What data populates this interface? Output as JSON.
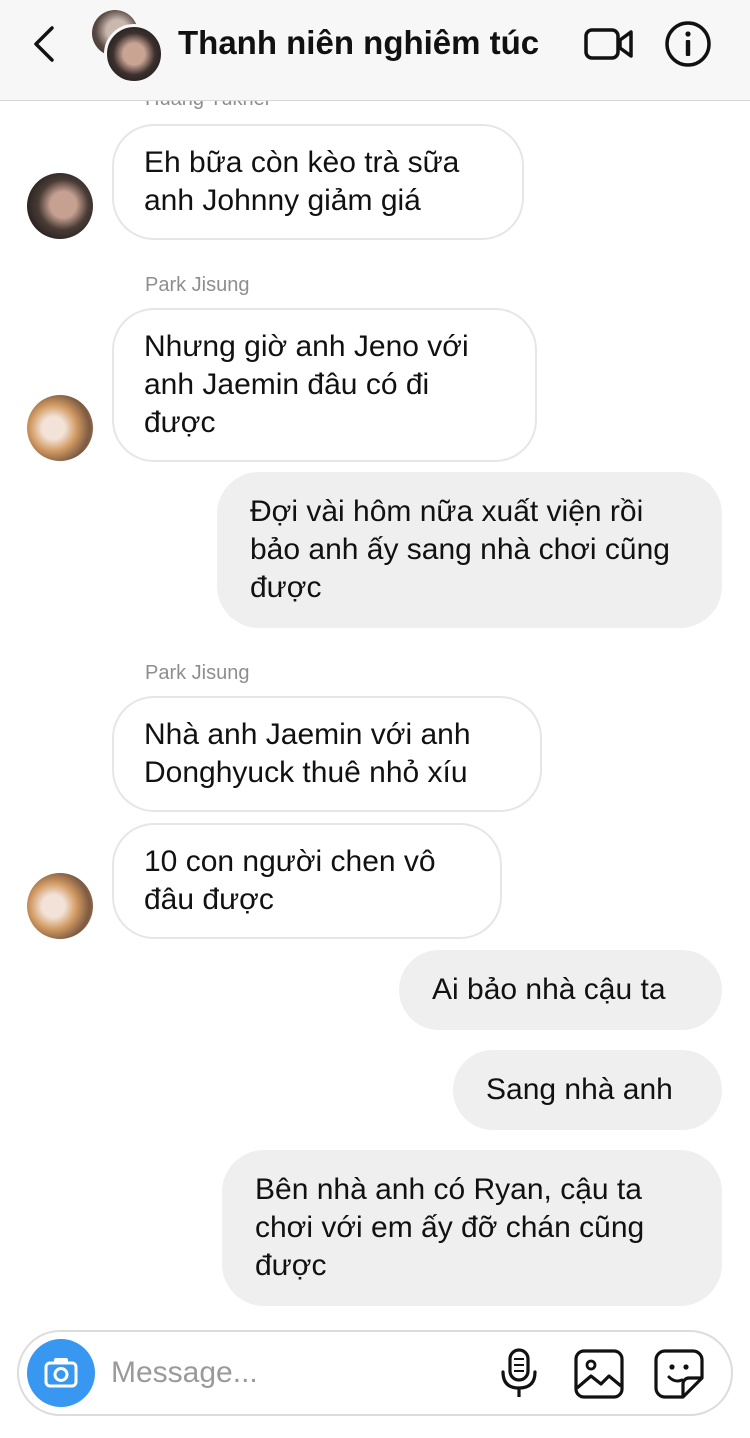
{
  "header": {
    "title": "Thanh niên nghiêm túc",
    "icons": [
      "back-chevron-icon",
      "video-call-icon",
      "info-icon"
    ]
  },
  "messages": {
    "m0": {
      "sender": "Huang Yukhei",
      "text": "Eh bữa còn kèo trà sữa anh Johnny giảm giá",
      "direction": "incoming"
    },
    "m1": {
      "sender": "Park Jisung",
      "text": "Nhưng giờ anh Jeno với anh Jaemin đâu có đi được",
      "direction": "incoming"
    },
    "m2": {
      "text": "Đợi vài hôm nữa xuất viện rồi bảo anh ấy sang nhà chơi cũng được",
      "direction": "outgoing"
    },
    "m3": {
      "sender": "Park Jisung",
      "text": "Nhà anh Jaemin với anh Donghyuck thuê nhỏ xíu",
      "direction": "incoming"
    },
    "m4": {
      "text": "10 con người chen vô đâu được",
      "direction": "incoming"
    },
    "m5": {
      "text": "Ai bảo nhà cậu ta",
      "direction": "outgoing"
    },
    "m6": {
      "text": "Sang nhà anh",
      "direction": "outgoing"
    },
    "m7": {
      "text": "Bên nhà anh có Ryan, cậu ta chơi với em ấy đỡ chán cũng được",
      "direction": "outgoing"
    }
  },
  "composer": {
    "placeholder": "Message...",
    "icons": [
      "camera-icon",
      "microphone-icon",
      "gallery-icon",
      "sticker-icon"
    ]
  },
  "colors": {
    "camera_button": "#3897f0",
    "outgoing_bubble": "#efefef",
    "incoming_border": "#e6e6e6",
    "sender_name": "#8e8e8e"
  }
}
